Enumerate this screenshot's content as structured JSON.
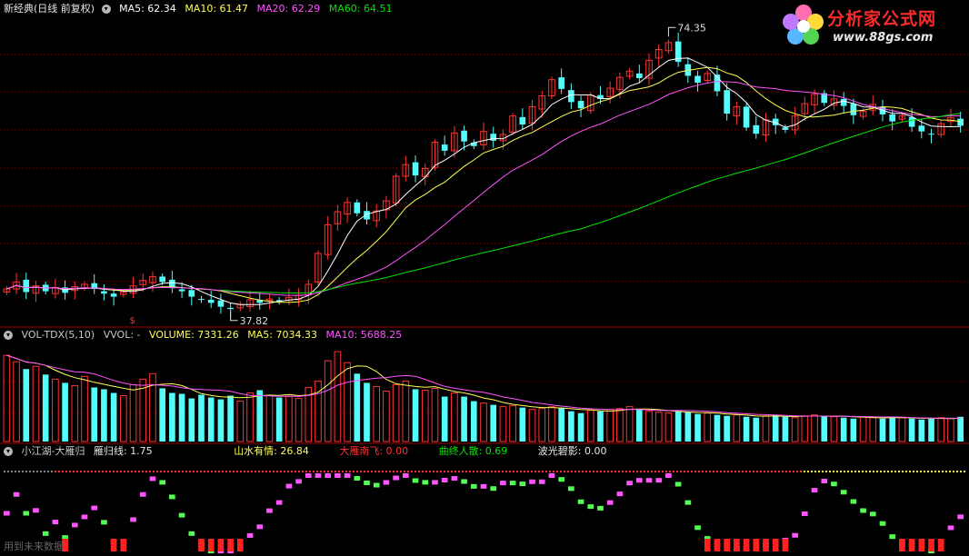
{
  "panel1": {
    "name": "新经典(日线 前复权)",
    "ma5": "MA5: 62.34",
    "ma10": "MA10: 61.47",
    "ma20": "MA20: 62.29",
    "ma60": "MA60: 64.51",
    "high_label": "74.35",
    "low_label": "37.82"
  },
  "panel2": {
    "name": "VOL-TDX(5,10)",
    "vvol": "VVOL: -",
    "volume": "VOLUME: 7331.26",
    "ma5": "MA5: 7034.33",
    "ma10": "MA10: 5688.25"
  },
  "panel3": {
    "name": "小江湖-大雁归",
    "f1": "雁归线: 1.75",
    "f2": "山水有情: 26.84",
    "f3": "大雁南飞: 0.00",
    "f4": "曲终人散: 0.69",
    "f5": "波光碧影: 0.00"
  },
  "footer": "用到未来数据",
  "logo": {
    "title": "分析家公式网",
    "url": "www.88gs.com"
  },
  "colors": {
    "up": "#ff3232",
    "down": "#54fcfc",
    "ma5": "#ffffff",
    "ma10": "#ffff54",
    "ma20": "#ff54ff",
    "ma60": "#00e600"
  },
  "chart_data": {
    "type": "candlestick",
    "price_range": [
      36.5,
      76.5
    ],
    "closes": [
      41.2,
      42.1,
      40.8,
      41.6,
      40.9,
      41.4,
      40.7,
      41.5,
      41.8,
      41.2,
      40.6,
      40.2,
      40.8,
      41.6,
      42.3,
      42.8,
      42.1,
      41.3,
      40.9,
      40.2,
      39.8,
      39.4,
      38.9,
      38.6,
      39.2,
      39.8,
      39.4,
      39.9,
      39.6,
      40.1,
      40.4,
      41.8,
      45.8,
      49.5,
      51.2,
      52.4,
      51.0,
      50.2,
      51.3,
      52.6,
      55.8,
      57.3,
      55.9,
      56.8,
      60.2,
      59.1,
      61.4,
      60.3,
      59.7,
      61.6,
      60.4,
      61.2,
      63.6,
      62.5,
      64.8,
      66.2,
      68.3,
      67.1,
      65.4,
      64.6,
      66.3,
      65.8,
      67.2,
      68.6,
      69.4,
      68.5,
      70.8,
      72.2,
      73.1,
      70.6,
      68.8,
      67.9,
      69.1,
      66.8,
      63.9,
      64.8,
      62.1,
      61.3,
      63.1,
      62.4,
      61.8,
      63.6,
      65.2,
      66.4,
      65.3,
      65.8,
      64.9,
      63.7,
      64.2,
      65.1,
      63.8,
      62.9,
      63.6,
      62.2,
      61.6,
      61.2,
      62.6,
      63.4,
      62.34
    ],
    "volumes": [
      9400,
      8700,
      7900,
      8200,
      7300,
      6800,
      6400,
      6100,
      7100,
      5900,
      5700,
      5300,
      5000,
      6200,
      6800,
      7400,
      5800,
      5300,
      5200,
      4700,
      5100,
      4800,
      4600,
      5000,
      4400,
      5300,
      5600,
      5000,
      4800,
      4900,
      4700,
      5900,
      6600,
      8800,
      9800,
      8600,
      7400,
      6400,
      6000,
      5500,
      6200,
      6600,
      5700,
      5600,
      5800,
      4900,
      5300,
      4900,
      4400,
      4200,
      4000,
      3800,
      3900,
      3700,
      3500,
      3600,
      3800,
      3700,
      3300,
      3100,
      3400,
      3300,
      3500,
      3600,
      3800,
      3500,
      3300,
      3200,
      3100,
      3300,
      3200,
      3000,
      3100,
      2900,
      2800,
      2900,
      2700,
      2600,
      2800,
      2900,
      2700,
      2600,
      2800,
      2900,
      2800,
      2700,
      2600,
      2500,
      2700,
      2600,
      2500,
      2700,
      2600,
      2500,
      2400,
      2500,
      2600,
      2500,
      2700
    ],
    "low_point": 37.82,
    "high_point": 74.35
  }
}
